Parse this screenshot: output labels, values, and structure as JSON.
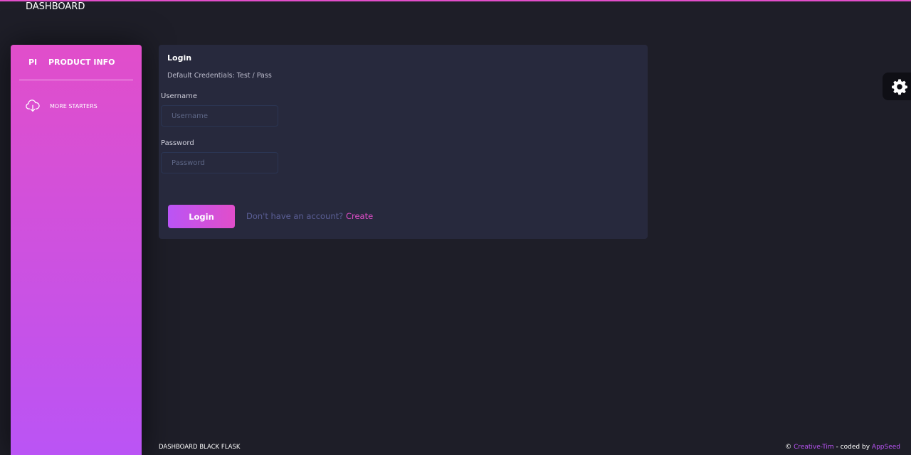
{
  "header": {
    "brand": "DASHBOARD"
  },
  "sidebar": {
    "logo_mini": "PI",
    "logo_text": "PRODUCT INFO",
    "items": [
      {
        "label": "MORE STARTERS",
        "icon": "cloud-download-icon"
      }
    ]
  },
  "login_card": {
    "title": "Login",
    "subtitle": "Default Credentials: Test / Pass",
    "username": {
      "label": "Username",
      "placeholder": "Username",
      "value": ""
    },
    "password": {
      "label": "Password",
      "placeholder": "Password",
      "value": ""
    },
    "button_label": "Login",
    "signup_prompt": "Don't have an account?",
    "signup_link": "Create"
  },
  "settings": {
    "icon": "gear-icon"
  },
  "footer": {
    "left": "DASHBOARD BLACK FLASK",
    "copyright": "©",
    "creative_tim": "Creative-Tim",
    "coded_by": "- coded by",
    "appseed": "AppSeed"
  },
  "colors": {
    "background": "#1e1e28",
    "card": "#27293d",
    "accent_pink": "#e14eca",
    "accent_purple": "#ba54f5",
    "link_muted": "#5b5f96"
  }
}
